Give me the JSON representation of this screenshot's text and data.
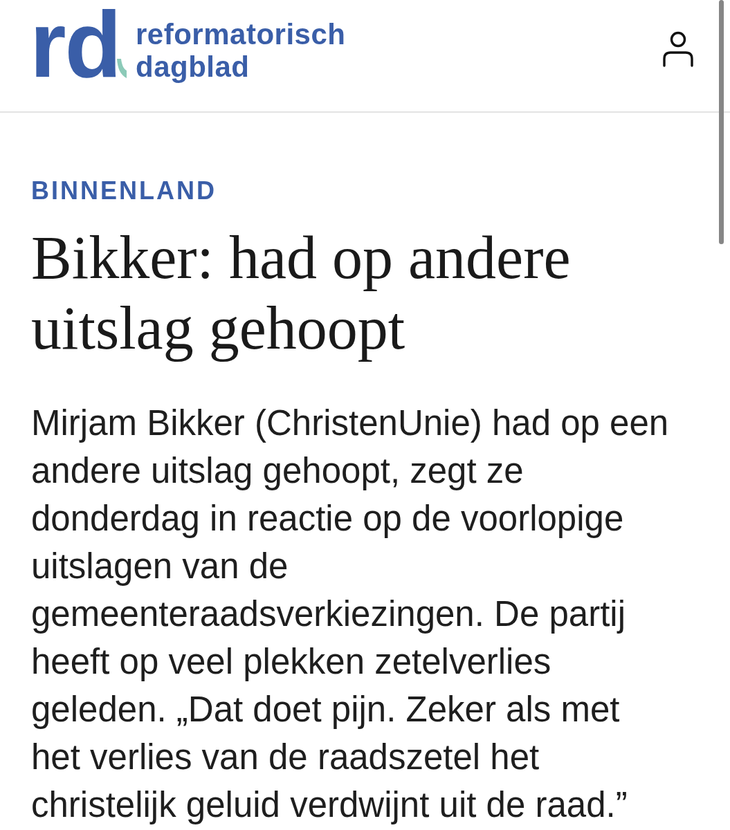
{
  "header": {
    "logo": {
      "mark": "rd",
      "name": "reformatorisch dagblad"
    }
  },
  "article": {
    "category": "BINNENLAND",
    "headline": "Bikker: had op andere uitslag gehoopt",
    "body": "Mirjam Bikker (ChristenUnie) had op een andere uitslag gehoopt, zegt ze donderdag in reactie op de voorlopige uitslagen van de gemeenteraadsverkiezingen. De partij heeft op veel plekken zetelverlies geleden. „Dat doet pijn. Zeker als met het verlies van de raadszetel het christelijk geluid verdwijnt uit de raad.”"
  }
}
